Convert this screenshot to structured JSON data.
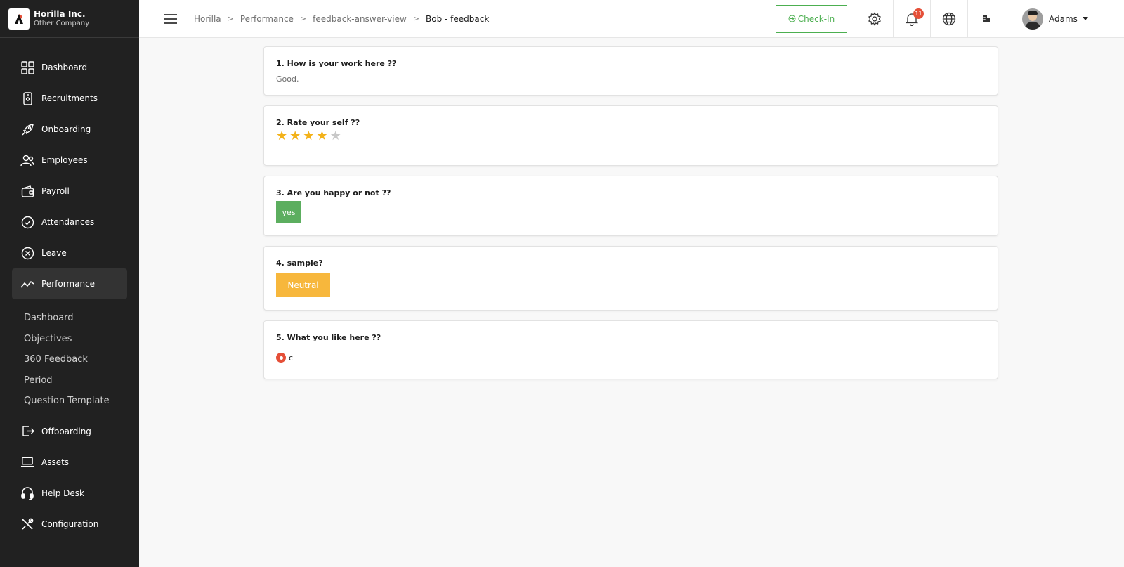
{
  "company": {
    "name": "Horilla Inc.",
    "subtitle": "Other Company"
  },
  "sidebar": {
    "items": [
      {
        "label": "Dashboard",
        "icon": "dashboard-grid-icon"
      },
      {
        "label": "Recruitments",
        "icon": "phone-id-icon"
      },
      {
        "label": "Onboarding",
        "icon": "rocket-icon"
      },
      {
        "label": "Employees",
        "icon": "users-icon"
      },
      {
        "label": "Payroll",
        "icon": "wallet-icon"
      },
      {
        "label": "Attendances",
        "icon": "check-circle-icon"
      },
      {
        "label": "Leave",
        "icon": "x-circle-icon"
      },
      {
        "label": "Performance",
        "icon": "trend-line-icon",
        "active": true
      }
    ],
    "performance_sub": [
      "Dashboard",
      "Objectives",
      "360 Feedback",
      "Period",
      "Question Template"
    ],
    "items_bottom": [
      {
        "label": "Offboarding",
        "icon": "exit-icon"
      },
      {
        "label": "Assets",
        "icon": "laptop-icon"
      },
      {
        "label": "Help Desk",
        "icon": "headset-icon"
      },
      {
        "label": "Configuration",
        "icon": "tools-icon"
      }
    ]
  },
  "header": {
    "breadcrumbs": [
      "Horilla",
      "Performance",
      "feedback-answer-view",
      "Bob - feedback"
    ],
    "checkin_label": "Check-In",
    "notification_count": "11",
    "user_name": "Adams"
  },
  "questions": [
    {
      "title": "1. How is your work here ??",
      "answer": "Good."
    },
    {
      "title": "2. Rate your self ??",
      "rating": 4,
      "max_rating": 5
    },
    {
      "title": "3. Are you happy or not ??",
      "answer": "yes",
      "color": "#5cae5f"
    },
    {
      "title": "4. sample?",
      "answer": "Neutral",
      "color": "#f7b73c"
    },
    {
      "title": "5. What you like here ??",
      "answer": "c"
    }
  ],
  "colors": {
    "accent": "#e54f38",
    "success": "#4caf50",
    "star": "#f3b21a",
    "star_empty": "#c8c8c8"
  }
}
